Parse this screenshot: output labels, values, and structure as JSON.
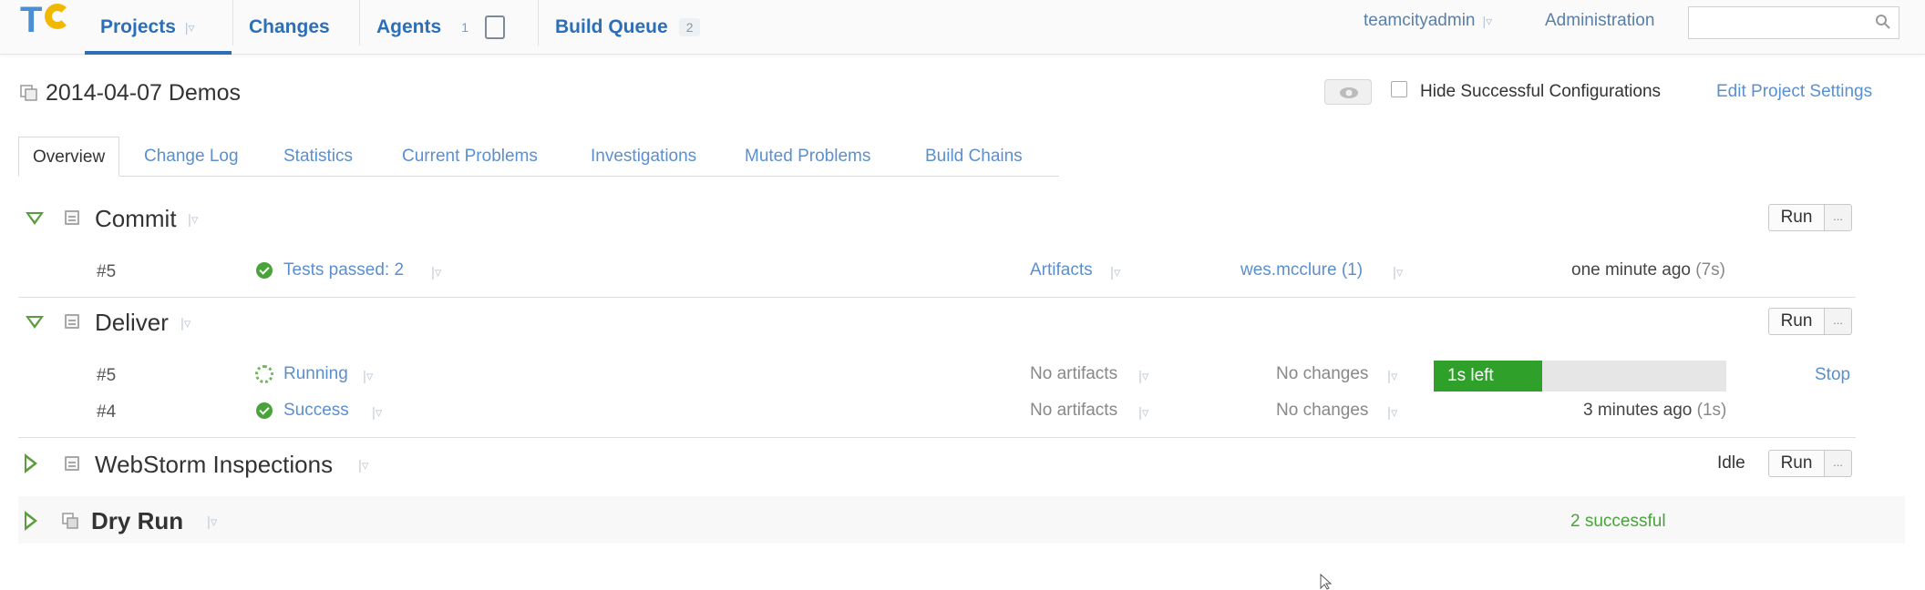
{
  "header": {
    "logo_text": "TC",
    "nav": {
      "projects": "Projects",
      "changes": "Changes",
      "agents": "Agents",
      "agents_count": "1",
      "build_queue": "Build Queue",
      "build_queue_count": "2"
    },
    "user": "teamcityadmin",
    "administration": "Administration",
    "search_placeholder": ""
  },
  "project": {
    "title": "2014-04-07 Demos",
    "hide_successful_label": "Hide Successful Configurations",
    "edit_settings_label": "Edit Project Settings"
  },
  "tabs": [
    {
      "label": "Overview",
      "active": true
    },
    {
      "label": "Change Log"
    },
    {
      "label": "Statistics"
    },
    {
      "label": "Current Problems"
    },
    {
      "label": "Investigations"
    },
    {
      "label": "Muted Problems"
    },
    {
      "label": "Build Chains"
    }
  ],
  "configs": {
    "commit": {
      "name": "Commit",
      "run_label": "Run",
      "more_label": "...",
      "builds": [
        {
          "number": "#5",
          "status": "Tests passed: 2",
          "artifacts": "Artifacts",
          "changes": "wes.mcclure (1)",
          "time": "one minute ago",
          "duration": "(7s)"
        }
      ]
    },
    "deliver": {
      "name": "Deliver",
      "run_label": "Run",
      "more_label": "...",
      "builds": [
        {
          "number": "#5",
          "status": "Running",
          "artifacts": "No artifacts",
          "changes": "No changes",
          "progress_text": "1s left",
          "progress_fraction": 0.37,
          "stop_label": "Stop"
        },
        {
          "number": "#4",
          "status": "Success",
          "artifacts": "No artifacts",
          "changes": "No changes",
          "time": "3 minutes ago",
          "duration": "(1s)"
        }
      ]
    },
    "webstorm": {
      "name": "WebStorm Inspections",
      "state": "Idle",
      "run_label": "Run",
      "more_label": "..."
    },
    "dry_run": {
      "name": "Dry Run",
      "summary": "2 successful"
    }
  },
  "colors": {
    "link": "#5a8fd0",
    "nav": "#2c6fb7",
    "success": "#49a33a",
    "progress": "#2fa12a",
    "expand_triangle": "#5b9c3e"
  }
}
